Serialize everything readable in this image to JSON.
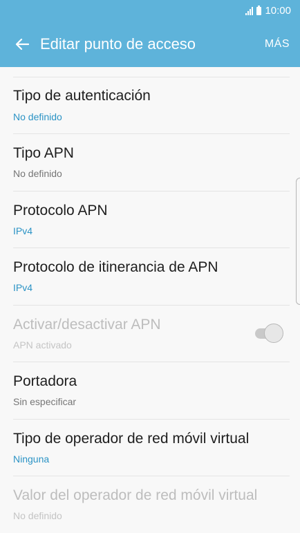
{
  "status_bar": {
    "time": "10:00",
    "icons": [
      "signal-icon",
      "battery-icon"
    ]
  },
  "app_bar": {
    "back_icon": "arrow-left-icon",
    "title": "Editar punto de acceso",
    "more_label": "MÁS"
  },
  "colors": {
    "header": "#5eb3da",
    "accent_text": "#2b93c5",
    "background": "#f8f8f8"
  },
  "settings": [
    {
      "title": "Tipo de autenticación",
      "value": "No definido"
    },
    {
      "title": "Tipo APN",
      "value": "No definido"
    },
    {
      "title": "Protocolo APN",
      "value": "IPv4"
    },
    {
      "title": "Protocolo de itinerancia de APN",
      "value": "IPv4"
    },
    {
      "title": "Activar/desactivar APN",
      "value": "APN activado",
      "toggle_on": true,
      "disabled": true
    },
    {
      "title": "Portadora",
      "value": "Sin especificar"
    },
    {
      "title": "Tipo de operador de red móvil virtual",
      "value": "Ninguna"
    },
    {
      "title": "Valor del operador de red móvil virtual",
      "value": "No definido",
      "disabled": true
    }
  ]
}
